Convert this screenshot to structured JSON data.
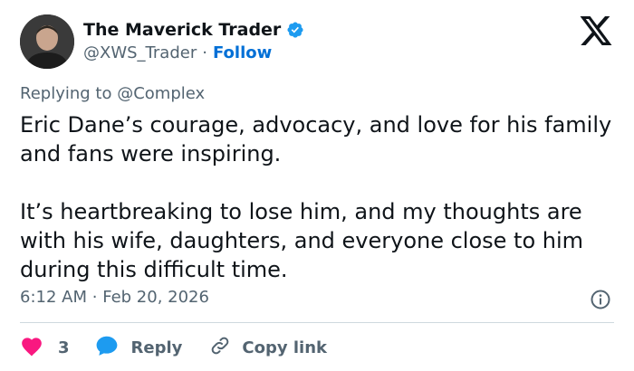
{
  "author": {
    "name": "The Maverick Trader",
    "handle": "@XWS_Trader",
    "separator": "·",
    "follow_label": "Follow"
  },
  "reply_context": {
    "prefix": "Replying to",
    "mention": "@Complex"
  },
  "tweet": {
    "paragraph_1": "Eric Dane’s courage, advocacy, and love for his family and fans were inspiring.",
    "paragraph_2": "It’s heartbreaking to lose him, and my thoughts are with his wife, daughters, and everyone close to him during this difficult time.",
    "time": "6:12 AM",
    "separator": "·",
    "date": "Feb 20, 2026"
  },
  "actions": {
    "like_count": "3",
    "reply_label": "Reply",
    "copy_link_label": "Copy link"
  },
  "icons": {
    "verified": "verified-badge-icon",
    "logo": "x-logo-icon",
    "info": "info-icon",
    "heart": "heart-icon",
    "reply": "reply-bubble-icon",
    "link": "link-icon"
  },
  "colors": {
    "accent": "#1d9bf0",
    "follow": "#006fd6",
    "heart": "#f91880",
    "muted": "#536471",
    "text": "#0f1419"
  }
}
